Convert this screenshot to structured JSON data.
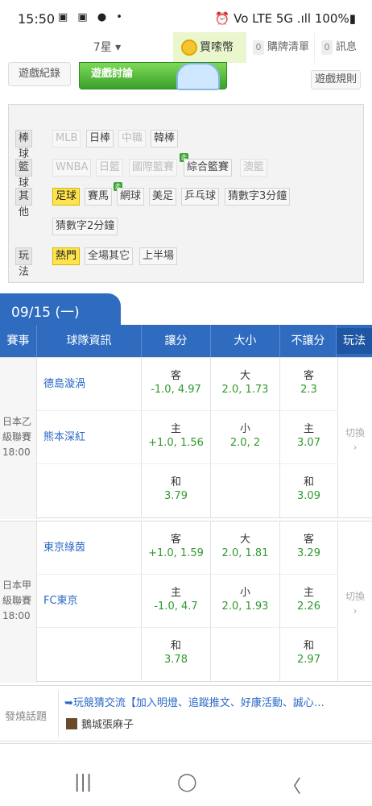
{
  "status": {
    "time": "15:50",
    "left_icons": "▣ ▣ ● •",
    "right": "⏰ Vo LTE 5G .ıll 100%▮"
  },
  "nav": {
    "star_select": "7星 ▾",
    "coin": "買嗦幣",
    "cart_count": "0",
    "cart": "購牌清單",
    "msg_count": "0",
    "msg": "訊息"
  },
  "tabs": {
    "record": "遊戲紀錄",
    "forum": "遊戲討論",
    "rules": "遊戲規則"
  },
  "filters": {
    "baseball": {
      "label": "棒球",
      "items": [
        "MLB",
        "日棒",
        "中職",
        "韓棒"
      ]
    },
    "basketball": {
      "label": "籃球",
      "items": [
        "WNBA",
        "日籃",
        "國際籃賽",
        "綜合籃賽",
        "澳籃"
      ]
    },
    "other": {
      "label": "其他",
      "items": [
        "足球",
        "賽馬",
        "網球",
        "美足",
        "乒乓球",
        "猜數字3分鐘",
        "猜數字2分鐘"
      ]
    },
    "play": {
      "label": "玩法",
      "items": [
        "熱門",
        "全場其它",
        "上半場"
      ]
    },
    "new_tag": "走"
  },
  "date": "09/15 (一)",
  "columns": {
    "league": "賽事",
    "team": "球隊資訊",
    "handicap": "讓分",
    "ou": "大小",
    "ml": "不讓分",
    "play": "玩法"
  },
  "matches": [
    {
      "league_l1": "日本乙",
      "league_l2": "級聯賽",
      "time": "18:00",
      "home": "德島漩渦",
      "away": "熊本深紅",
      "r1": {
        "h_k": "客",
        "h_v": "-1.0, 4.97",
        "o_k": "大",
        "o_v": "2.0, 1.73",
        "m_k": "客",
        "m_v": "2.3"
      },
      "r2": {
        "h_k": "主",
        "h_v": "+1.0, 1.56",
        "o_k": "小",
        "o_v": "2.0, 2",
        "m_k": "主",
        "m_v": "3.07"
      },
      "r3": {
        "h_k": "和",
        "h_v": "3.79",
        "m_k": "和",
        "m_v": "3.09"
      },
      "switch": "切換",
      "switch_arrow": "›"
    },
    {
      "league_l1": "日本甲",
      "league_l2": "級聯賽",
      "time": "18:00",
      "home": "東京綠茵",
      "away": "FC東京",
      "r1": {
        "h_k": "客",
        "h_v": "+1.0, 1.59",
        "o_k": "大",
        "o_v": "2.0, 1.81",
        "m_k": "客",
        "m_v": "3.29"
      },
      "r2": {
        "h_k": "主",
        "h_v": "-1.0, 4.7",
        "o_k": "小",
        "o_v": "2.0, 1.93",
        "m_k": "主",
        "m_v": "2.26"
      },
      "r3": {
        "h_k": "和",
        "h_v": "3.78",
        "m_k": "和",
        "m_v": "2.97"
      },
      "switch": "切換",
      "switch_arrow": "›"
    }
  ],
  "hot": {
    "label": "發燒話題",
    "title": "➥玩競猜交流【加入明燈、追蹤推文、好康活動、誠心…",
    "author": "鵝城張麻子"
  },
  "navbar": {
    "recent": "|||",
    "home": "◯",
    "back": "〈"
  }
}
